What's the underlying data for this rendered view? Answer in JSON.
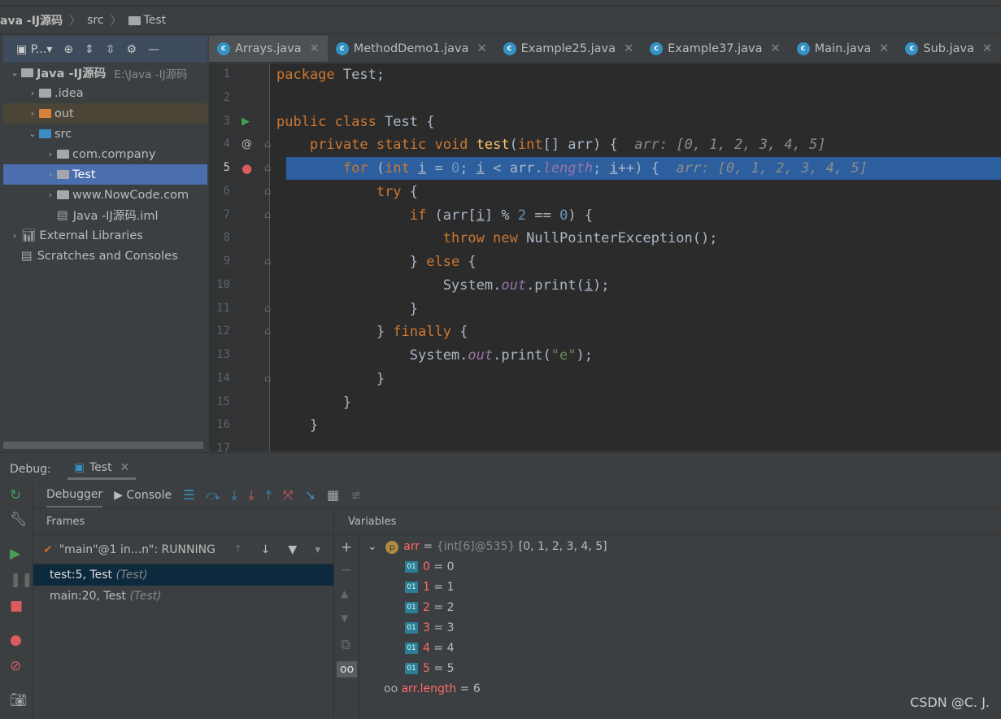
{
  "breadcrumb": [
    "ava -IJ源码",
    "src",
    "Test"
  ],
  "project": {
    "toolbar_label": "P...",
    "tree": [
      {
        "label": "Java -IJ源码",
        "path": "E:\\Java -IJ源码",
        "indent": 0,
        "chev": "v",
        "icon": "module",
        "bold": true
      },
      {
        "label": ".idea",
        "indent": 1,
        "chev": ">",
        "icon": "folder"
      },
      {
        "label": "out",
        "indent": 1,
        "chev": ">",
        "icon": "folder-orange",
        "state": "out"
      },
      {
        "label": "src",
        "indent": 1,
        "chev": "v",
        "icon": "folder-blue"
      },
      {
        "label": "com.company",
        "indent": 2,
        "chev": ">",
        "icon": "package"
      },
      {
        "label": "Test",
        "indent": 2,
        "chev": ">",
        "icon": "package",
        "state": "sel"
      },
      {
        "label": "www.NowCode.com",
        "indent": 2,
        "chev": ">",
        "icon": "package"
      },
      {
        "label": "Java -IJ源码.iml",
        "indent": 2,
        "chev": "",
        "icon": "file"
      },
      {
        "label": "External Libraries",
        "indent": 0,
        "chev": ">",
        "icon": "libraries"
      },
      {
        "label": "Scratches and Consoles",
        "indent": 0,
        "chev": "",
        "icon": "scratches"
      }
    ]
  },
  "tabs": [
    {
      "label": "Arrays.java",
      "active": true
    },
    {
      "label": "MethodDemo1.java"
    },
    {
      "label": "Example25.java"
    },
    {
      "label": "Example37.java"
    },
    {
      "label": "Main.java"
    },
    {
      "label": "Sub.java"
    }
  ],
  "code": [
    [
      [
        "kw",
        "package "
      ],
      [
        "",
        "Test;"
      ]
    ],
    [],
    [
      [
        "kw",
        "public class "
      ],
      [
        "",
        "Test {"
      ]
    ],
    [
      [
        "",
        "    "
      ],
      [
        "kw",
        "private static void "
      ],
      [
        "fn",
        "test"
      ],
      [
        "",
        "("
      ],
      [
        "kw",
        "int"
      ],
      [
        "",
        "[] arr) {  "
      ],
      [
        "hint",
        "arr: [0, 1, 2, 3, 4, 5]"
      ]
    ],
    [
      [
        "",
        "        "
      ],
      [
        "kw",
        "for "
      ],
      [
        "",
        "("
      ],
      [
        "kw",
        "int "
      ],
      [
        "ul",
        "i"
      ],
      [
        "",
        " = "
      ],
      [
        "num",
        "0"
      ],
      [
        "",
        "; "
      ],
      [
        "ul",
        "i"
      ],
      [
        "",
        " < arr."
      ],
      [
        "st",
        "length"
      ],
      [
        "",
        "; "
      ],
      [
        "ul",
        "i"
      ],
      [
        "",
        "++) {  "
      ],
      [
        "hint",
        "arr: [0, 1, 2, 3, 4, 5]"
      ]
    ],
    [
      [
        "",
        "            "
      ],
      [
        "kw",
        "try "
      ],
      [
        "",
        "{"
      ]
    ],
    [
      [
        "",
        "                "
      ],
      [
        "kw",
        "if "
      ],
      [
        "",
        "(arr["
      ],
      [
        "ul",
        "i"
      ],
      [
        "",
        "] % "
      ],
      [
        "num",
        "2"
      ],
      [
        "",
        " == "
      ],
      [
        "num",
        "0"
      ],
      [
        "",
        ") {"
      ]
    ],
    [
      [
        "",
        "                    "
      ],
      [
        "kw",
        "throw new "
      ],
      [
        "",
        "NullPointerException();"
      ]
    ],
    [
      [
        "",
        "                } "
      ],
      [
        "kw",
        "else "
      ],
      [
        "",
        "{"
      ]
    ],
    [
      [
        "",
        "                    System."
      ],
      [
        "st",
        "out"
      ],
      [
        "",
        ".print("
      ],
      [
        "ul",
        "i"
      ],
      [
        "",
        ");"
      ]
    ],
    [
      [
        "",
        "                }"
      ]
    ],
    [
      [
        "",
        "            } "
      ],
      [
        "kw",
        "finally "
      ],
      [
        "",
        "{"
      ]
    ],
    [
      [
        "",
        "                System."
      ],
      [
        "st",
        "out"
      ],
      [
        "",
        ".print("
      ],
      [
        "str",
        "\"e\""
      ],
      [
        "",
        ");"
      ]
    ],
    [
      [
        "",
        "            }"
      ]
    ],
    [
      [
        "",
        "        }"
      ]
    ],
    [
      [
        "",
        "    }"
      ]
    ],
    []
  ],
  "debug": {
    "label": "Debug:",
    "session": "Test",
    "tabs": [
      "Debugger",
      "Console"
    ],
    "frames_header": "Frames",
    "variables_header": "Variables",
    "thread": "\"main\"@1 in...n\": RUNNING",
    "frames": [
      {
        "loc": "test:5, Test",
        "cls": "(Test)",
        "selected": true
      },
      {
        "loc": "main:20, Test",
        "cls": "(Test)"
      }
    ],
    "arr": {
      "name": "arr",
      "value": "{int[6]@535}",
      "items": "[0, 1, 2, 3, 4, 5]"
    },
    "elements": [
      {
        "i": "0",
        "v": "0"
      },
      {
        "i": "1",
        "v": "1"
      },
      {
        "i": "2",
        "v": "2"
      },
      {
        "i": "3",
        "v": "3"
      },
      {
        "i": "4",
        "v": "4"
      },
      {
        "i": "5",
        "v": "5"
      }
    ],
    "watch": {
      "name": "arr.length",
      "v": "6"
    }
  },
  "watermark": "CSDN @C.   J."
}
